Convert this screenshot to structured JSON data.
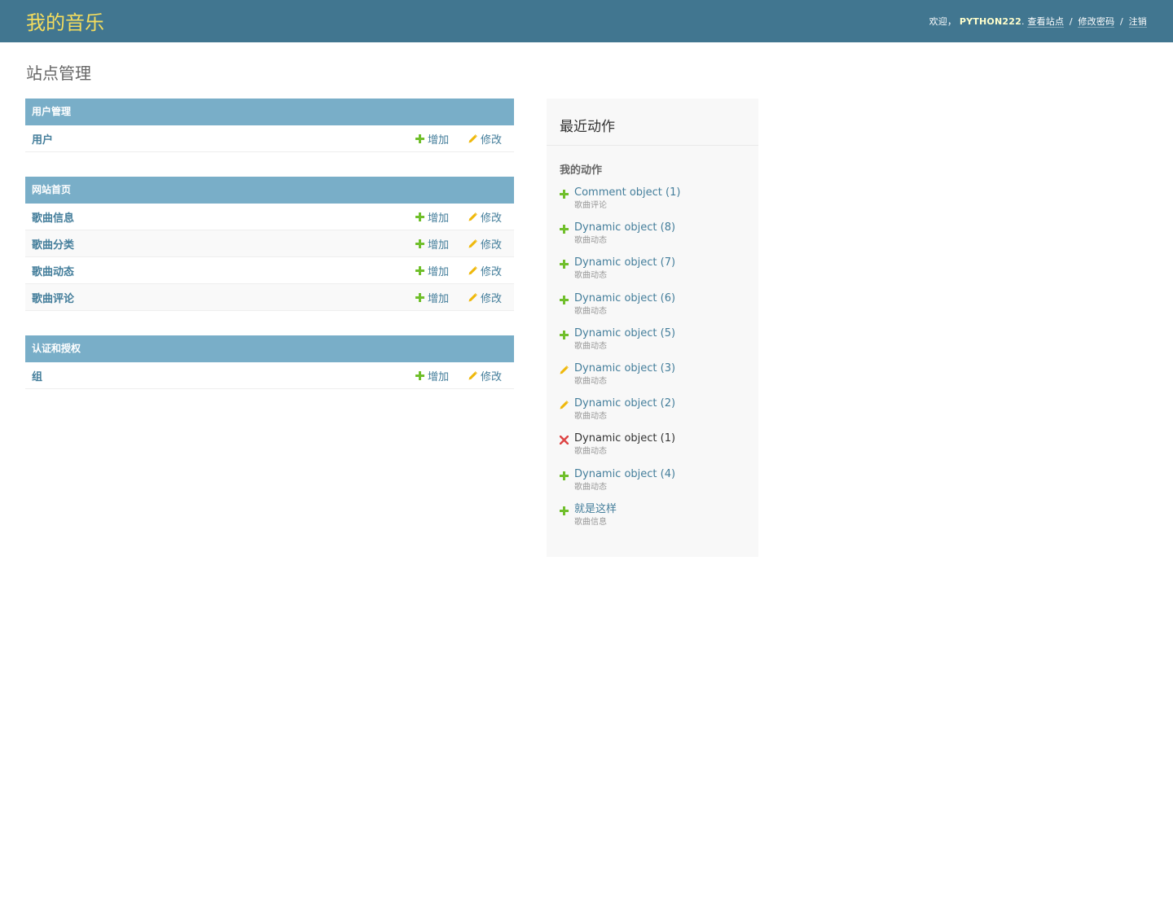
{
  "header": {
    "site_name": "我的音乐",
    "welcome": "欢迎，",
    "username": "PYTHON222",
    "after_username": ".",
    "links": [
      "查看站点",
      "修改密码",
      "注销"
    ],
    "separator": "/"
  },
  "page_title": "站点管理",
  "modules": [
    {
      "caption": "用户管理",
      "models": [
        {
          "name": "用户",
          "add": "增加",
          "change": "修改"
        }
      ]
    },
    {
      "caption": "网站首页",
      "models": [
        {
          "name": "歌曲信息",
          "add": "增加",
          "change": "修改"
        },
        {
          "name": "歌曲分类",
          "add": "增加",
          "change": "修改"
        },
        {
          "name": "歌曲动态",
          "add": "增加",
          "change": "修改"
        },
        {
          "name": "歌曲评论",
          "add": "增加",
          "change": "修改"
        }
      ]
    },
    {
      "caption": "认证和授权",
      "models": [
        {
          "name": "组",
          "add": "增加",
          "change": "修改"
        }
      ]
    }
  ],
  "recent_actions": {
    "title": "最近动作",
    "subtitle": "我的动作",
    "items": [
      {
        "icon": "add-icon",
        "label": "Comment object (1)",
        "type": "歌曲评论"
      },
      {
        "icon": "add-icon",
        "label": "Dynamic object (8)",
        "type": "歌曲动态"
      },
      {
        "icon": "add-icon",
        "label": "Dynamic object (7)",
        "type": "歌曲动态"
      },
      {
        "icon": "add-icon",
        "label": "Dynamic object (6)",
        "type": "歌曲动态"
      },
      {
        "icon": "add-icon",
        "label": "Dynamic object (5)",
        "type": "歌曲动态"
      },
      {
        "icon": "change-icon",
        "label": "Dynamic object (3)",
        "type": "歌曲动态"
      },
      {
        "icon": "change-icon",
        "label": "Dynamic object (2)",
        "type": "歌曲动态"
      },
      {
        "icon": "delete-icon",
        "label": "Dynamic object (1)",
        "type": "歌曲动态"
      },
      {
        "icon": "add-icon",
        "label": "Dynamic object (4)",
        "type": "歌曲动态"
      },
      {
        "icon": "add-icon",
        "label": "就是这样",
        "type": "歌曲信息"
      }
    ]
  },
  "colors": {
    "header_bg": "#417690",
    "brand": "#f5dd5d",
    "module_caption_bg": "#79aec8",
    "link": "#447e9b",
    "add_icon": "#70bf2b",
    "change_icon": "#efb80b",
    "delete_icon": "#dd4646"
  }
}
